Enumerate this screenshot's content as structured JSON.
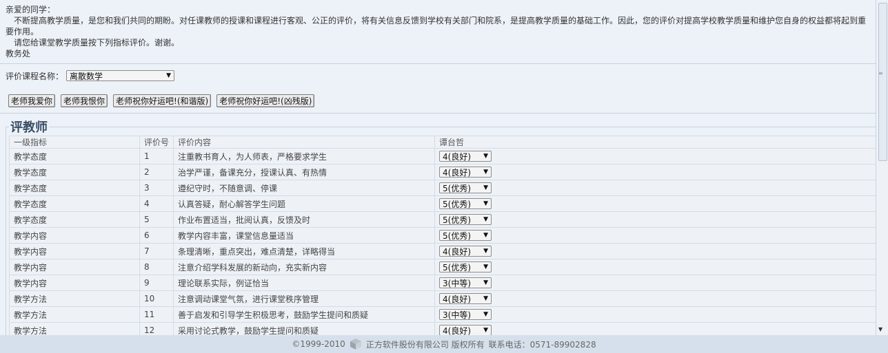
{
  "intro": {
    "greeting": "亲爱的同学：",
    "para1": "不断提高教学质量，是您和我们共同的期盼。对任课教师的授课和课程进行客观、公正的评价，将有关信息反馈到学校有关部门和院系，是提高教学质量的基础工作。因此，您的评价对提高学校教学质量和维护您自身的权益都将起到重要作用。",
    "para2": "请您给课堂教学质量按下列指标评价。谢谢。",
    "signoff": "教务处"
  },
  "course": {
    "label": "评价课程名称：",
    "selected": "离散数学"
  },
  "buttons": [
    "老师我爱你",
    "老师我恨你",
    "老师祝你好运吧!(和谐版)",
    "老师祝你好运吧!(凶残版)"
  ],
  "section_title": "评教师",
  "table": {
    "headers": [
      "一级指标",
      "评价号",
      "评价内容",
      "谭台哲"
    ],
    "rows": [
      {
        "category": "教学态度",
        "no": "1",
        "content": "注重教书育人，为人师表，严格要求学生",
        "rating": "4(良好)"
      },
      {
        "category": "教学态度",
        "no": "2",
        "content": "治学严谨，备课充分，授课认真、有热情",
        "rating": "4(良好)"
      },
      {
        "category": "教学态度",
        "no": "3",
        "content": "遵纪守时，不随意调、停课",
        "rating": "5(优秀)"
      },
      {
        "category": "教学态度",
        "no": "4",
        "content": "认真答疑，耐心解答学生问题",
        "rating": "5(优秀)"
      },
      {
        "category": "教学态度",
        "no": "5",
        "content": "作业布置适当，批阅认真，反馈及时",
        "rating": "5(优秀)"
      },
      {
        "category": "教学内容",
        "no": "6",
        "content": "教学内容丰富，课堂信息量适当",
        "rating": "5(优秀)"
      },
      {
        "category": "教学内容",
        "no": "7",
        "content": "条理清晰，重点突出，难点清楚，详略得当",
        "rating": "4(良好)"
      },
      {
        "category": "教学内容",
        "no": "8",
        "content": "注意介绍学科发展的新动向，充实新内容",
        "rating": "5(优秀)"
      },
      {
        "category": "教学内容",
        "no": "9",
        "content": "理论联系实际，例证恰当",
        "rating": "3(中等)"
      },
      {
        "category": "教学方法",
        "no": "10",
        "content": "注意调动课堂气氛，进行课堂秩序管理",
        "rating": "4(良好)"
      },
      {
        "category": "教学方法",
        "no": "11",
        "content": "善于启发和引导学生积极思考，鼓励学生提问和质疑",
        "rating": "3(中等)"
      },
      {
        "category": "教学方法",
        "no": "12",
        "content": "采用讨论式教学，鼓励学生提问和质疑",
        "rating": "4(良好)"
      }
    ]
  },
  "footer": {
    "copyright": "©1999-2010",
    "company": "正方软件股份有限公司 版权所有",
    "phone": "联系电话：0571-89902828"
  }
}
